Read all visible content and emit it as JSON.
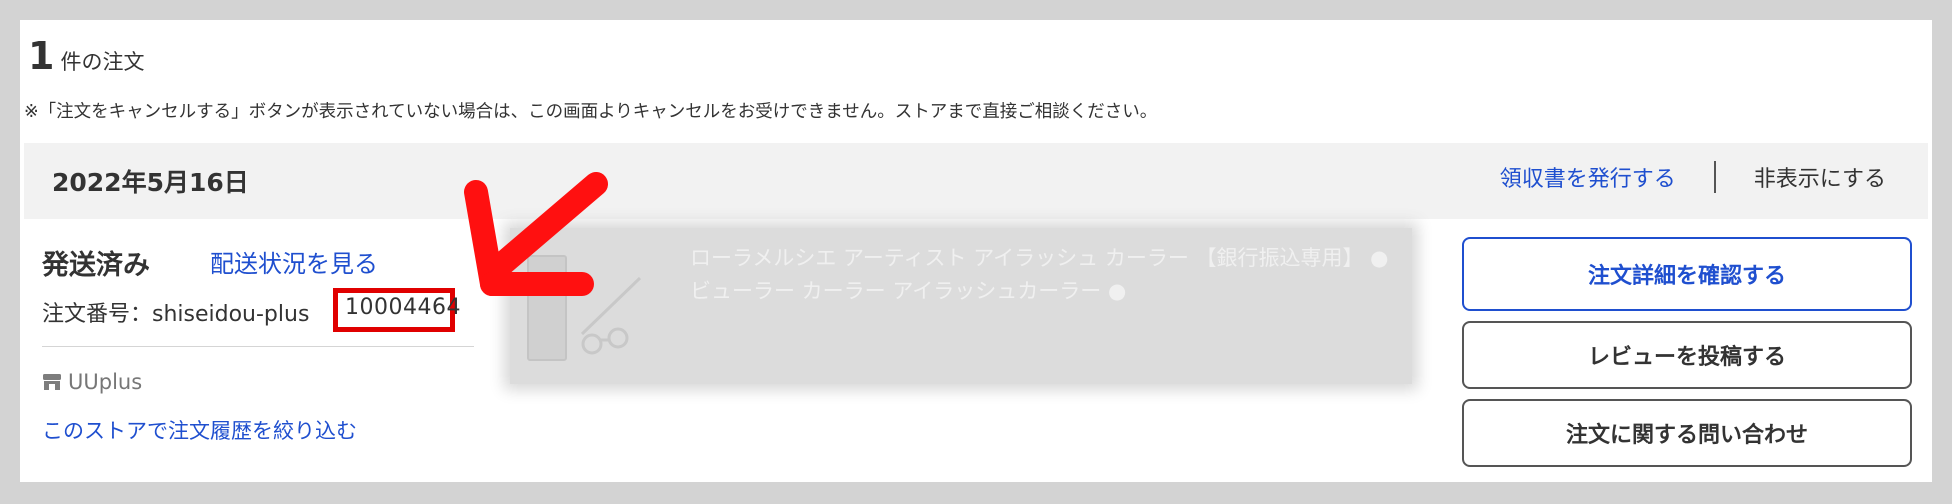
{
  "orders_summary": {
    "count": "1",
    "count_label": "件の注文",
    "notice": "※「注文をキャンセルする」ボタンが表示されていない場合は、この画面よりキャンセルをお受けできません。ストアまで直接ご相談ください。"
  },
  "order": {
    "date": "2022年5月16日",
    "receipt_link": "領収書を発行する",
    "hide_link": "非表示にする",
    "status": "発送済み",
    "tracking_link": "配送状況を見る",
    "order_number_label": "注文番号：shiseidou-plus",
    "order_number_digits": "10004464",
    "store_name": "UUplus",
    "store_filter_link": "このストアで注文履歴を絞り込む",
    "product_title": "ローラメルシエ アーティスト アイラッシュ カーラー 【銀行振込専用】 ● ビューラー カーラー アイラッシュカーラー ●",
    "buttons": {
      "detail": "注文詳細を確認する",
      "review": "レビューを投稿する",
      "inquiry": "注文に関する問い合わせ"
    }
  },
  "colors": {
    "link_blue": "#1f4fcf",
    "annotation_red": "#e00000",
    "header_bg": "#f2f2f2"
  },
  "icons": {
    "store": "store-icon",
    "annotation_arrow": "red-arrow-annotation",
    "product": "eyelash-curler-thumbnail"
  }
}
